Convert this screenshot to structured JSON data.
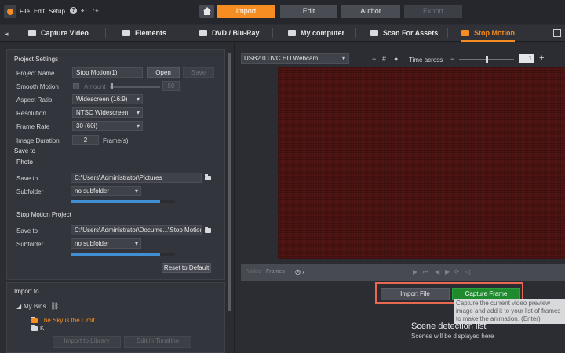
{
  "menu": {
    "file": "File",
    "edit": "Edit",
    "setup": "Setup"
  },
  "top_tabs": {
    "import": "Import",
    "edit": "Edit",
    "author": "Author",
    "export": "Export"
  },
  "sub_tabs": {
    "capture_video": "Capture Video",
    "elements": "Elements",
    "dvd": "DVD / Blu-Ray",
    "my_computer": "My computer",
    "scan": "Scan For Assets",
    "stop_motion": "Stop Motion"
  },
  "project": {
    "heading": "Project Settings",
    "name_label": "Project Name",
    "name_value": "Stop Motion(1)",
    "open_btn": "Open",
    "save_btn": "Save",
    "smooth_label": "Smooth Motion",
    "amount_label": "Amount",
    "amount_value": "50",
    "aspect_label": "Aspect Ratio",
    "aspect_value": "Widescreen (16:9)",
    "resolution_label": "Resolution",
    "resolution_value": "NTSC Widescreen",
    "framerate_label": "Frame Rate",
    "framerate_value": "30 (60i)",
    "duration_label": "Image Duration",
    "duration_value": "2",
    "duration_unit": "Frame(s)"
  },
  "save_to": {
    "heading": "Save to",
    "photo_heading": "Photo",
    "photo_save_label": "Save to",
    "photo_path": "C:\\Users\\Administrator\\Pictures",
    "photo_subfolder_label": "Subfolder",
    "photo_subfolder_value": "no subfolder",
    "photo_progress": 0.86,
    "smp_heading": "Stop Motion Project",
    "smp_save_label": "Save to",
    "smp_path": "C:\\Users\\Administrator\\Docume...\\Stop Motion",
    "smp_subfolder_label": "Subfolder",
    "smp_subfolder_value": "no subfolder",
    "smp_progress": 0.86,
    "reset_btn": "Reset to Default"
  },
  "import_to": {
    "heading": "Import to",
    "bins_label": "My Bins",
    "bin_active": "The Sky is the Limit",
    "bin_other": "K",
    "import_library_btn": "Import to Library",
    "edit_timeline_btn": "Edit in Timeline"
  },
  "capture": {
    "webcam": "USB2.0 UVC HD Webcam",
    "time_across_label": "Time across",
    "time_across_value": "1",
    "zoom_level": 0.5,
    "video_label": "Video",
    "frames_label": "Frames",
    "import_file_btn": "Import File",
    "capture_frame_btn": "Capture Frame",
    "tooltip": "Capture the current video preview image and add it to your list of frames to make the animation. (Enter)"
  },
  "scene": {
    "title": "Scene detection list",
    "subtitle": "Scenes will be displayed here"
  },
  "colors": {
    "accent": "#f58d22",
    "capture_green": "#1f8a2e",
    "highlight": "#e8694f",
    "preview": "#4e1513"
  },
  "icons": [
    "home-icon",
    "help-icon",
    "undo-icon",
    "redo-icon",
    "camera-icon",
    "film-icon",
    "disc-icon",
    "folder-icon",
    "search-icon",
    "stop-motion-icon",
    "expand-icon",
    "clock-icon",
    "play-icon"
  ]
}
